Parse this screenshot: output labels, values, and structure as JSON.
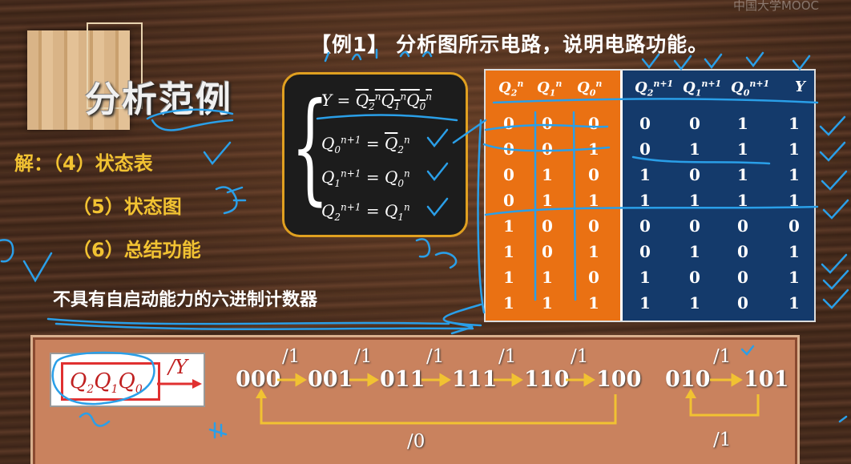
{
  "watermark": "中国大学MOOC",
  "section_title": "分析范例",
  "example_title": "【例1】 分析图所示电路，说明电路功能。",
  "solution_prefix": "解：",
  "steps": [
    "（4）状态表",
    "（5）状态图",
    "（6）总结功能"
  ],
  "conclusion": "不具有自启动能力的六进制计数器",
  "table": {
    "headers_left": [
      "Q2n",
      "Q1n",
      "Q0n"
    ],
    "headers_right": [
      "Q2n+1",
      "Q1n+1",
      "Q0n+1",
      "Y"
    ],
    "rows": [
      [
        "0",
        "0",
        "0",
        "0",
        "0",
        "1",
        "1"
      ],
      [
        "0",
        "0",
        "1",
        "0",
        "1",
        "1",
        "1"
      ],
      [
        "0",
        "1",
        "0",
        "1",
        "0",
        "1",
        "1"
      ],
      [
        "0",
        "1",
        "1",
        "1",
        "1",
        "1",
        "1"
      ],
      [
        "1",
        "0",
        "0",
        "0",
        "0",
        "0",
        "0"
      ],
      [
        "1",
        "0",
        "1",
        "0",
        "1",
        "0",
        "1"
      ],
      [
        "1",
        "1",
        "0",
        "1",
        "0",
        "0",
        "1"
      ],
      [
        "1",
        "1",
        "1",
        "1",
        "1",
        "0",
        "1"
      ]
    ]
  },
  "state_diagram": {
    "legend_y": "/Y",
    "main_states": [
      "000",
      "001",
      "011",
      "111",
      "110",
      "100"
    ],
    "main_labels": [
      "/1",
      "/1",
      "/1",
      "/1",
      "/1"
    ],
    "main_return_label": "/0",
    "side_states": [
      "010",
      "101"
    ],
    "side_label": "/1",
    "side_return_label": "/1"
  },
  "colors": {
    "orange": "#ea7113",
    "navy": "#143a6b",
    "yellow": "#f1c232",
    "panel": "#c9825e"
  }
}
